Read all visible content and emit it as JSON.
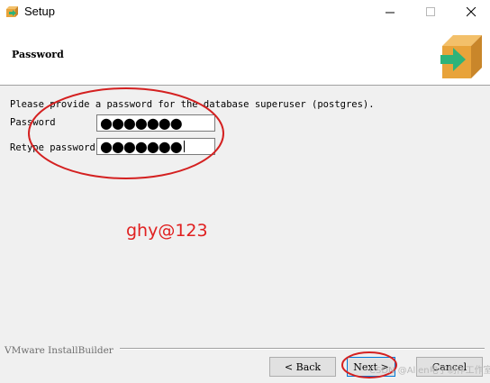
{
  "window": {
    "title": "Setup",
    "minimize_glyph": "—",
    "maximize_glyph": "☐",
    "close_glyph": "✕"
  },
  "header": {
    "title": "Password",
    "logo_icon": "installer-box-arrow-icon"
  },
  "body": {
    "intro": "Please provide a password for the database superuser (postgres).",
    "password_label": "Password",
    "retype_label": "Retype password",
    "password_value": "●●●●●●●",
    "retype_value": "●●●●●●●"
  },
  "annotation": {
    "text": "ghy@123",
    "color": "#e02020"
  },
  "footer": {
    "brand": "VMware InstallBuilder",
    "back_label": "< Back",
    "next_label": "Next >",
    "cancel_label": "Cancel"
  },
  "watermark": "CSDN @Allen电子制作工作室",
  "colors": {
    "accent_green": "#2db37a",
    "box_orange": "#e8a33a",
    "annotation_red": "#e02020"
  }
}
